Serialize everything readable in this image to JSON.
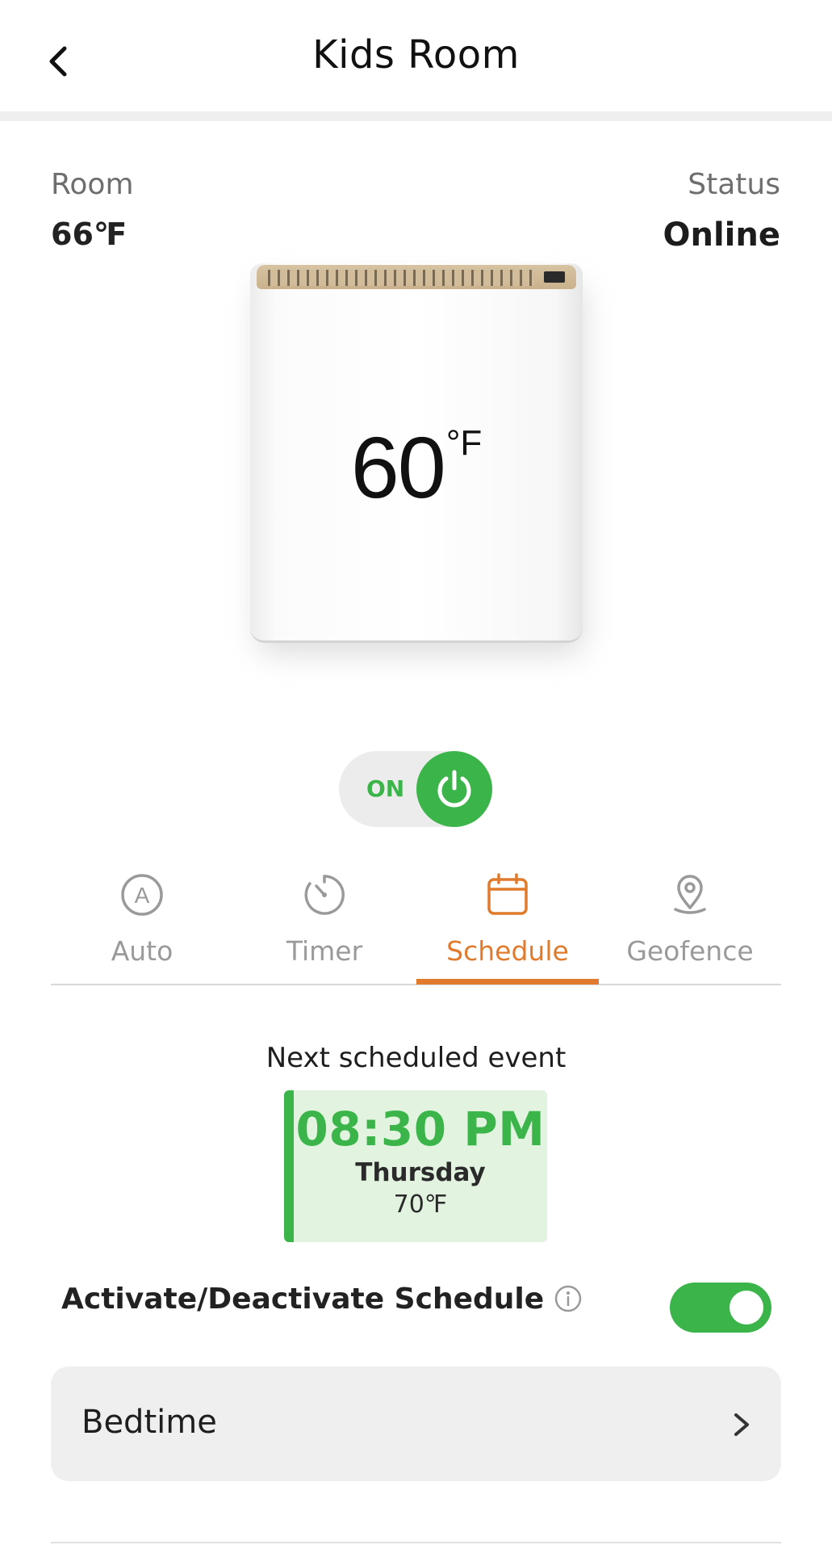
{
  "header": {
    "title": "Kids Room",
    "back_icon": "chevron-left-icon"
  },
  "room": {
    "label": "Room",
    "value": "66℉"
  },
  "status": {
    "label": "Status",
    "value": "Online"
  },
  "heater": {
    "set_temperature": "60",
    "unit": "°F"
  },
  "power": {
    "label": "ON",
    "state": "on",
    "icon": "power-icon",
    "accent": "#3bb54a"
  },
  "tabs": [
    {
      "label": "Auto",
      "icon": "auto-mode-icon",
      "active": false
    },
    {
      "label": "Timer",
      "icon": "timer-icon",
      "active": false
    },
    {
      "label": "Schedule",
      "icon": "calendar-icon",
      "active": true
    },
    {
      "label": "Geofence",
      "icon": "location-pin-icon",
      "active": false
    }
  ],
  "next_event": {
    "title": "Next scheduled event",
    "time": "08:30 PM",
    "day": "Thursday",
    "temperature": "70℉"
  },
  "schedule_toggle": {
    "label": "Activate/Deactivate Schedule",
    "state": "on",
    "info_icon": "info-icon"
  },
  "schedules": [
    {
      "label": "Bedtime",
      "icon": "chevron-right-icon"
    }
  ],
  "colors": {
    "accent_green": "#3bb54a",
    "accent_orange": "#e07b2e",
    "event_background": "#e2f4e0"
  }
}
